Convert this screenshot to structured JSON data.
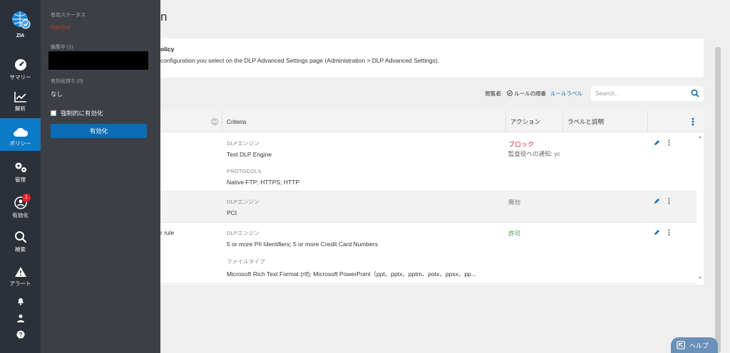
{
  "nav": {
    "logo_label": "ZIA",
    "items": [
      {
        "label": "サマリー",
        "icon": "gauge-icon"
      },
      {
        "label": "解析",
        "icon": "chart-icon"
      },
      {
        "label": "ポリシー",
        "icon": "cloud-icon"
      },
      {
        "label": "管理",
        "icon": "gears-icon"
      },
      {
        "label": "有効化",
        "icon": "user-activate-icon",
        "badge": "1"
      },
      {
        "label": "検索",
        "icon": "search-icon"
      },
      {
        "label": "アラート",
        "icon": "alert-icon"
      }
    ]
  },
  "flyout": {
    "status_label": "有効ステータス",
    "status_value": "Inactive",
    "editing_label": "編集中 (1)",
    "pending_label": "有効化待ち (0)",
    "pending_value": "なし",
    "force_checkbox_label": "強制的に有効化",
    "activate_button": "有効化"
  },
  "main": {
    "page_title_fragment": "n",
    "info_title_fragment": "olicy",
    "info_text_fragment": "configuration you select on the DLP Advanced Settings page (Administration > DLP Advanced Settings).",
    "toolbar": {
      "view_label": "閲覧者:",
      "rule_order_label": "ルールの順番",
      "rule_label_link": "ルールラベル",
      "search_placeholder": "Search..."
    },
    "table": {
      "headers": {
        "criteria": "Criteria",
        "action": "アクション",
        "label_desc": "ラベルと説明"
      },
      "rows": [
        {
          "name_fragment": "",
          "criteria": [
            {
              "label": "DLPエンジン",
              "value": "Test DLP Engine"
            },
            {
              "label": "PROTOCOLS",
              "value": "Native FTP; HTTPS; HTTP"
            }
          ],
          "action": "ブロック",
          "action_sub": "監査役への通知: yc"
        },
        {
          "name_fragment": "",
          "criteria": [
            {
              "label": "DLPエンジン",
              "value": "PCI"
            }
          ],
          "action": "無効",
          "action_sub": ""
        },
        {
          "name_fragment": "r rule",
          "criteria": [
            {
              "label": "DLPエンジン",
              "value": "5 or more PII Identifiers; 5 or more Credit Card Numbers"
            },
            {
              "label": "ファイルタイプ",
              "value": "Microsoft Rich Text Format (rtf); Microsoft PowerPoint（ppt、pptx、pptm、potx、ppsx、pp..."
            }
          ],
          "action": "許可",
          "action_sub": ""
        }
      ]
    }
  },
  "help_label": "ヘルプ",
  "colors": {
    "nav_bg": "#2c3038",
    "flyout_bg": "#3c4046",
    "active_blue": "#0b7ac7",
    "block_red": "#d9262c",
    "allow_green": "#3a9a3a"
  }
}
